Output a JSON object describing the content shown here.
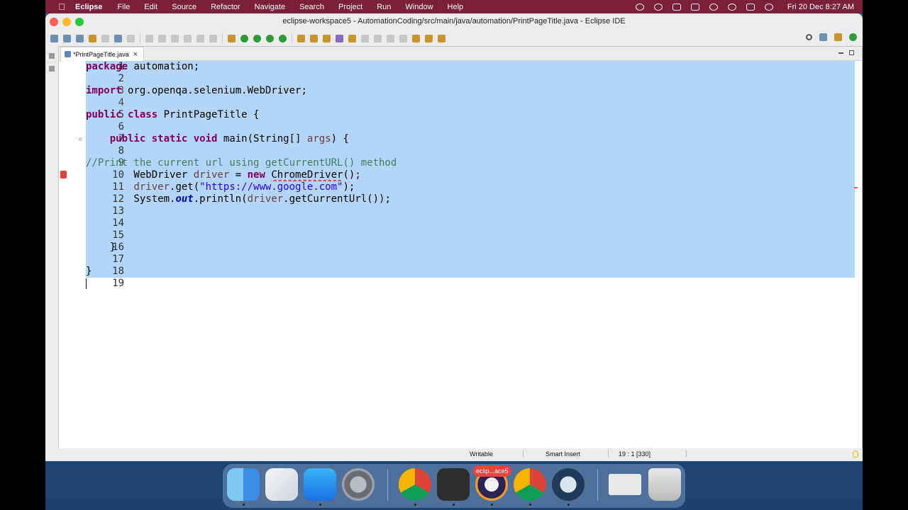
{
  "menubar": {
    "items": [
      "Eclipse",
      "File",
      "Edit",
      "Source",
      "Refactor",
      "Navigate",
      "Search",
      "Project",
      "Run",
      "Window",
      "Help"
    ],
    "clock": "Fri 20 Dec  8:27 AM"
  },
  "window": {
    "title": "eclipse-workspace5 - AutomationCoding/src/main/java/automation/PrintPageTitle.java - Eclipse IDE"
  },
  "editor": {
    "tab_label": "*PrintPageTitle.java",
    "tab_close": "×",
    "line_numbers": [
      "1",
      "2",
      "3",
      "4",
      "5",
      "6",
      "7",
      "8",
      "9",
      "10",
      "11",
      "12",
      "13",
      "14",
      "15",
      "16",
      "17",
      "18",
      "19"
    ],
    "code": {
      "l1_kw": "package",
      "l1_rest": " automation;",
      "l3_kw": "import",
      "l3_rest": " org.openqa.selenium.WebDriver;",
      "l5_kw1": "public",
      "l5_kw2": "class",
      "l5_rest": " PrintPageTitle {",
      "l7_indent": "    ",
      "l7_kw1": "public",
      "l7_kw2": "static",
      "l7_kw3": "void",
      "l7_mid": " main(String[] ",
      "l7_arg": "args",
      "l7_end": ") {",
      "l9_comment": "//Print the current url using getCurrentURL() method",
      "l10_a": "        WebDriver ",
      "l10_var": "driver",
      "l10_b": " = ",
      "l10_kw": "new",
      "l10_c": " ",
      "l10_err": "ChromeDriver",
      "l10_d": "();",
      "l11_a": "        ",
      "l11_var": "driver",
      "l11_b": ".get(",
      "l11_str": "\"https://www.google.com\"",
      "l11_c": ");",
      "l12_a": "        System.",
      "l12_fld": "out",
      "l12_b": ".println(",
      "l12_var": "driver",
      "l12_c": ".getCurrentUrl());",
      "l16": "    }",
      "l18": "}"
    }
  },
  "statusbar": {
    "writable": "Writable",
    "insert_mode": "Smart Insert",
    "position": "19 : 1 [330]"
  },
  "dock": {
    "badge": "eclip...ace5",
    "apps": [
      "finder-icon",
      "launchpad-icon",
      "app-store-icon",
      "system-preferences-icon",
      "chrome-icon",
      "sublime-text-icon",
      "eclipse-icon",
      "chrome-icon",
      "quicktime-icon",
      "window-preview-icon",
      "trash-icon"
    ]
  }
}
